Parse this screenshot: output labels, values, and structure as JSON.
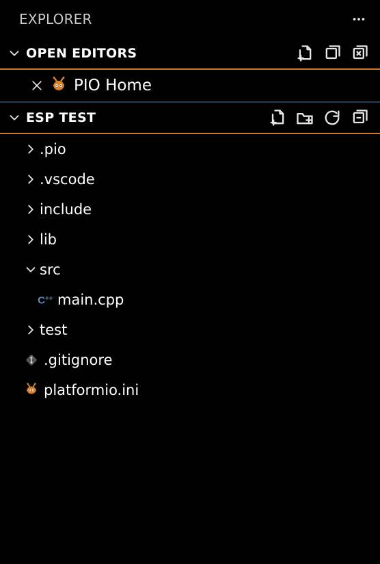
{
  "panel": {
    "title": "EXPLORER"
  },
  "openEditors": {
    "title": "OPEN EDITORS",
    "items": [
      {
        "label": "PIO Home"
      }
    ]
  },
  "project": {
    "title": "ESP TEST",
    "tree": [
      {
        "label": ".pio",
        "kind": "folder",
        "expanded": false,
        "indent": 1
      },
      {
        "label": ".vscode",
        "kind": "folder",
        "expanded": false,
        "indent": 1
      },
      {
        "label": "include",
        "kind": "folder",
        "expanded": false,
        "indent": 1
      },
      {
        "label": "lib",
        "kind": "folder",
        "expanded": false,
        "indent": 1
      },
      {
        "label": "src",
        "kind": "folder",
        "expanded": true,
        "indent": 1
      },
      {
        "label": "main.cpp",
        "kind": "cpp",
        "expanded": null,
        "indent": 2
      },
      {
        "label": "test",
        "kind": "folder",
        "expanded": false,
        "indent": 1
      },
      {
        "label": ".gitignore",
        "kind": "git",
        "expanded": null,
        "indent": 1
      },
      {
        "label": "platformio.ini",
        "kind": "pio",
        "expanded": null,
        "indent": 1
      }
    ]
  }
}
